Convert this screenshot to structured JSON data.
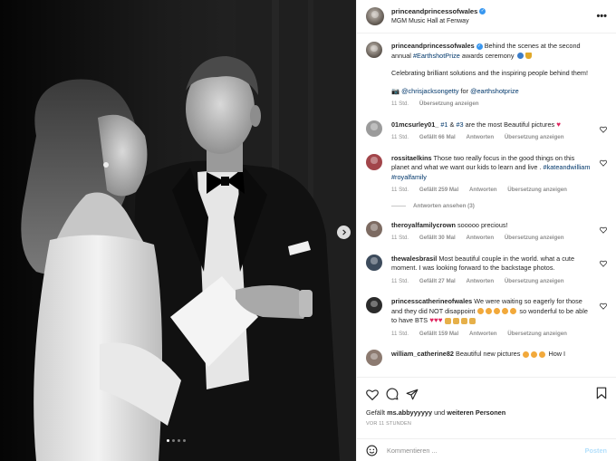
{
  "header": {
    "username": "princeandprincessofwales",
    "location": "MGM Music Hall at Fenway",
    "more": "•••"
  },
  "caption": {
    "username": "princeandprincessofwales",
    "text1": "Behind the scenes at the second annual",
    "hashtag": "#EarthshotPrize",
    "text2": "awards ceremony",
    "line2": "Celebrating brilliant solutions and the inspiring people behind them!",
    "credit_prefix": "📷",
    "credit_user1": "@chrisjacksongetty",
    "credit_for": "for",
    "credit_user2": "@earthshotprize",
    "time": "11 Std.",
    "translate": "Übersetzung anzeigen"
  },
  "comments": [
    {
      "username": "01mcsurley01_",
      "tag1": "#1",
      "amp": "&",
      "tag2": "#3",
      "text": "are the most Beautiful pictures",
      "time": "11 Std.",
      "likes": "Gefällt 66 Mal",
      "reply": "Antworten",
      "translate": "Übersetzung anzeigen"
    },
    {
      "username": "rossitaelkins",
      "text": "Those two really focus in the good things on this planet and what we want our kids to learn and live .",
      "tags": "#kateandwilliam #royalfamily",
      "time": "11 Std.",
      "likes": "Gefällt 259 Mal",
      "reply": "Antworten",
      "translate": "Übersetzung anzeigen",
      "view_replies": "Antworten ansehen (3)"
    },
    {
      "username": "theroyalfamilycrown",
      "text": "sooooo precious!",
      "time": "11 Std.",
      "likes": "Gefällt 30 Mal",
      "reply": "Antworten",
      "translate": "Übersetzung anzeigen"
    },
    {
      "username": "thewalesbrasil",
      "text": "Most beautiful couple in the world. what a cute moment. I was looking forward to the backstage photos.",
      "time": "11 Std.",
      "likes": "Gefällt 27 Mal",
      "reply": "Antworten",
      "translate": "Übersetzung anzeigen"
    },
    {
      "username": "princesscatherineofwales",
      "text1": "We were waiting so eagerly for those and they did NOT disappoint",
      "text2": "so wonderful to be able to have BTS",
      "time": "11 Std.",
      "likes": "Gefällt 159 Mal",
      "reply": "Antworten",
      "translate": "Übersetzung anzeigen"
    },
    {
      "username": "william_catherine82",
      "text": "Beautiful new pictures",
      "tail": "How I"
    }
  ],
  "footer": {
    "liked_by_prefix": "Gefällt",
    "liked_by_user": "ms.abbyyyyyy",
    "liked_by_and": "und",
    "liked_by_others": "weiteren Personen",
    "timestamp": "VOR 11 STUNDEN",
    "comment_placeholder": "Kommentieren ...",
    "post_label": "Posten"
  },
  "colors": {
    "link": "#00376b",
    "verified": "#3897f0",
    "post_disabled": "#b2dffc",
    "heart": "#ed4956"
  },
  "carousel": {
    "slide_count": 4,
    "active_index": 0
  }
}
